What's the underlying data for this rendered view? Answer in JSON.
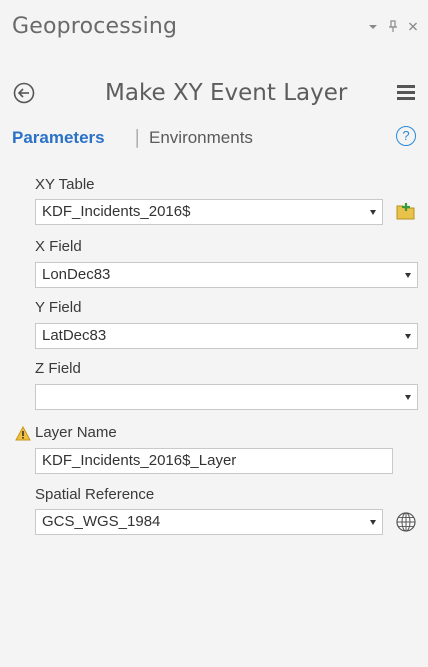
{
  "header": {
    "title": "Geoprocessing",
    "icons": [
      "pin-dropdown-icon",
      "pin-icon",
      "close-icon"
    ]
  },
  "tool": {
    "title": "Make XY Event Layer"
  },
  "tabs": {
    "parameters": "Parameters",
    "separator": "|",
    "environments": "Environments",
    "help": "?"
  },
  "params": {
    "xy_table": {
      "label": "XY Table",
      "value": "KDF_Incidents_2016$"
    },
    "x_field": {
      "label": "X Field",
      "value": "LonDec83"
    },
    "y_field": {
      "label": "Y Field",
      "value": "LatDec83"
    },
    "z_field": {
      "label": "Z Field",
      "value": ""
    },
    "layer_name": {
      "label": "Layer Name",
      "value": "KDF_Incidents_2016$_Layer"
    },
    "spatial_ref": {
      "label": "Spatial Reference",
      "value": "GCS_WGS_1984"
    }
  },
  "colors": {
    "accent": "#2b72c7",
    "warning": "#f0c040",
    "background": "#f4f4f4"
  }
}
